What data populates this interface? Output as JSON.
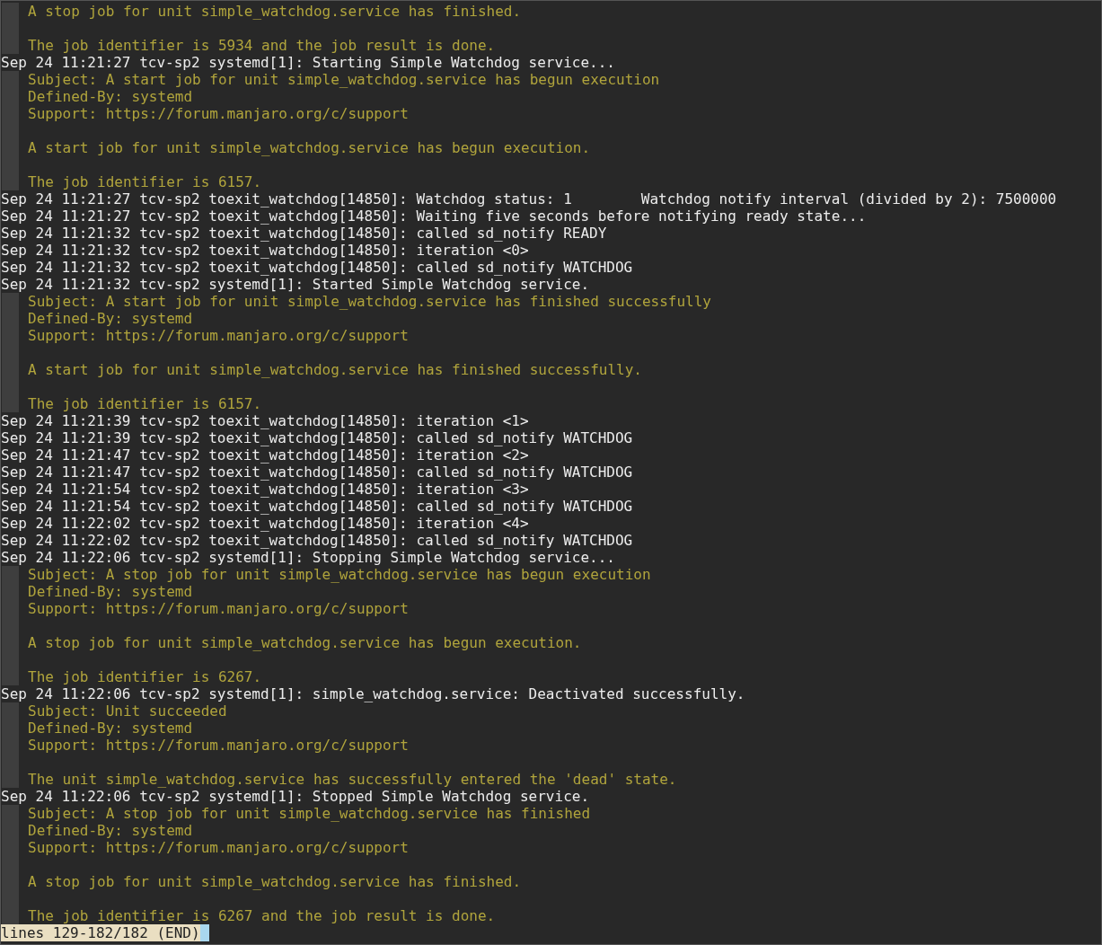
{
  "lines": [
    {
      "kind": "catalog",
      "text": "A stop job for unit simple_watchdog.service has finished."
    },
    {
      "kind": "catalog-blank"
    },
    {
      "kind": "catalog",
      "text": "The job identifier is 5934 and the job result is done."
    },
    {
      "kind": "log",
      "text": "Sep 24 11:21:27 tcv-sp2 systemd[1]: Starting Simple Watchdog service..."
    },
    {
      "kind": "catalog",
      "text": "Subject: A start job for unit simple_watchdog.service has begun execution"
    },
    {
      "kind": "catalog",
      "text": "Defined-By: systemd"
    },
    {
      "kind": "catalog",
      "text": "Support: https://forum.manjaro.org/c/support"
    },
    {
      "kind": "catalog-blank"
    },
    {
      "kind": "catalog",
      "text": "A start job for unit simple_watchdog.service has begun execution."
    },
    {
      "kind": "catalog-blank"
    },
    {
      "kind": "catalog",
      "text": "The job identifier is 6157."
    },
    {
      "kind": "log",
      "text": "Sep 24 11:21:27 tcv-sp2 toexit_watchdog[14850]: Watchdog status: 1        Watchdog notify interval (divided by 2): 7500000"
    },
    {
      "kind": "log",
      "text": "Sep 24 11:21:27 tcv-sp2 toexit_watchdog[14850]: Waiting five seconds before notifying ready state..."
    },
    {
      "kind": "log",
      "text": "Sep 24 11:21:32 tcv-sp2 toexit_watchdog[14850]: called sd_notify READY"
    },
    {
      "kind": "log",
      "text": "Sep 24 11:21:32 tcv-sp2 toexit_watchdog[14850]: iteration <0>"
    },
    {
      "kind": "log",
      "text": "Sep 24 11:21:32 tcv-sp2 toexit_watchdog[14850]: called sd_notify WATCHDOG"
    },
    {
      "kind": "log",
      "text": "Sep 24 11:21:32 tcv-sp2 systemd[1]: Started Simple Watchdog service."
    },
    {
      "kind": "catalog",
      "text": "Subject: A start job for unit simple_watchdog.service has finished successfully"
    },
    {
      "kind": "catalog",
      "text": "Defined-By: systemd"
    },
    {
      "kind": "catalog",
      "text": "Support: https://forum.manjaro.org/c/support"
    },
    {
      "kind": "catalog-blank"
    },
    {
      "kind": "catalog",
      "text": "A start job for unit simple_watchdog.service has finished successfully."
    },
    {
      "kind": "catalog-blank"
    },
    {
      "kind": "catalog",
      "text": "The job identifier is 6157."
    },
    {
      "kind": "log",
      "text": "Sep 24 11:21:39 tcv-sp2 toexit_watchdog[14850]: iteration <1>"
    },
    {
      "kind": "log",
      "text": "Sep 24 11:21:39 tcv-sp2 toexit_watchdog[14850]: called sd_notify WATCHDOG"
    },
    {
      "kind": "log",
      "text": "Sep 24 11:21:47 tcv-sp2 toexit_watchdog[14850]: iteration <2>"
    },
    {
      "kind": "log",
      "text": "Sep 24 11:21:47 tcv-sp2 toexit_watchdog[14850]: called sd_notify WATCHDOG"
    },
    {
      "kind": "log",
      "text": "Sep 24 11:21:54 tcv-sp2 toexit_watchdog[14850]: iteration <3>"
    },
    {
      "kind": "log",
      "text": "Sep 24 11:21:54 tcv-sp2 toexit_watchdog[14850]: called sd_notify WATCHDOG"
    },
    {
      "kind": "log",
      "text": "Sep 24 11:22:02 tcv-sp2 toexit_watchdog[14850]: iteration <4>"
    },
    {
      "kind": "log",
      "text": "Sep 24 11:22:02 tcv-sp2 toexit_watchdog[14850]: called sd_notify WATCHDOG"
    },
    {
      "kind": "log",
      "text": "Sep 24 11:22:06 tcv-sp2 systemd[1]: Stopping Simple Watchdog service..."
    },
    {
      "kind": "catalog",
      "text": "Subject: A stop job for unit simple_watchdog.service has begun execution"
    },
    {
      "kind": "catalog",
      "text": "Defined-By: systemd"
    },
    {
      "kind": "catalog",
      "text": "Support: https://forum.manjaro.org/c/support"
    },
    {
      "kind": "catalog-blank"
    },
    {
      "kind": "catalog",
      "text": "A stop job for unit simple_watchdog.service has begun execution."
    },
    {
      "kind": "catalog-blank"
    },
    {
      "kind": "catalog",
      "text": "The job identifier is 6267."
    },
    {
      "kind": "log",
      "text": "Sep 24 11:22:06 tcv-sp2 systemd[1]: simple_watchdog.service: Deactivated successfully."
    },
    {
      "kind": "catalog",
      "text": "Subject: Unit succeeded"
    },
    {
      "kind": "catalog",
      "text": "Defined-By: systemd"
    },
    {
      "kind": "catalog",
      "text": "Support: https://forum.manjaro.org/c/support"
    },
    {
      "kind": "catalog-blank"
    },
    {
      "kind": "catalog",
      "text": "The unit simple_watchdog.service has successfully entered the 'dead' state."
    },
    {
      "kind": "log",
      "text": "Sep 24 11:22:06 tcv-sp2 systemd[1]: Stopped Simple Watchdog service."
    },
    {
      "kind": "catalog",
      "text": "Subject: A stop job for unit simple_watchdog.service has finished"
    },
    {
      "kind": "catalog",
      "text": "Defined-By: systemd"
    },
    {
      "kind": "catalog",
      "text": "Support: https://forum.manjaro.org/c/support"
    },
    {
      "kind": "catalog-blank"
    },
    {
      "kind": "catalog",
      "text": "A stop job for unit simple_watchdog.service has finished."
    },
    {
      "kind": "catalog-blank"
    },
    {
      "kind": "catalog",
      "text": "The job identifier is 6267 and the job result is done."
    }
  ],
  "status_bar": {
    "text": "lines 129-182/182 (END)"
  }
}
